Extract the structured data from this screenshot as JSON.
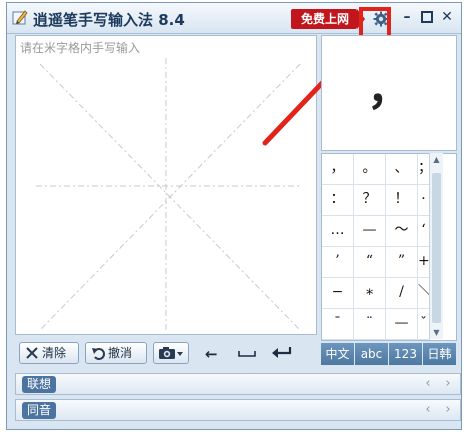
{
  "window": {
    "title": "逍遥笔手写输入法 8.4",
    "promo_label": "免费上网"
  },
  "canvas": {
    "placeholder": "请在米字格内手写输入"
  },
  "toolbar": {
    "clear_label": "清除",
    "undo_label": "撤消",
    "left_glyph": "←",
    "space_glyph": "␣",
    "enter_glyph": "↵"
  },
  "preview": {
    "char": "，"
  },
  "candidates": [
    "，",
    "。",
    "、",
    "；",
    "：",
    "？",
    "！",
    "·",
    "…",
    "—",
    "～",
    "‘",
    "’",
    "“",
    "”",
    "+",
    "−",
    "∗",
    "/",
    "＼",
    "¯",
    "¨",
    "—",
    "ˇ"
  ],
  "modes": [
    "中文",
    "abc",
    "123",
    "日韩"
  ],
  "panels": {
    "lianxiang": "联想",
    "tongyin": "同音"
  },
  "colors": {
    "accent": "#4d789f",
    "promo": "#c0161c",
    "highlight_box": "#e2231a"
  }
}
